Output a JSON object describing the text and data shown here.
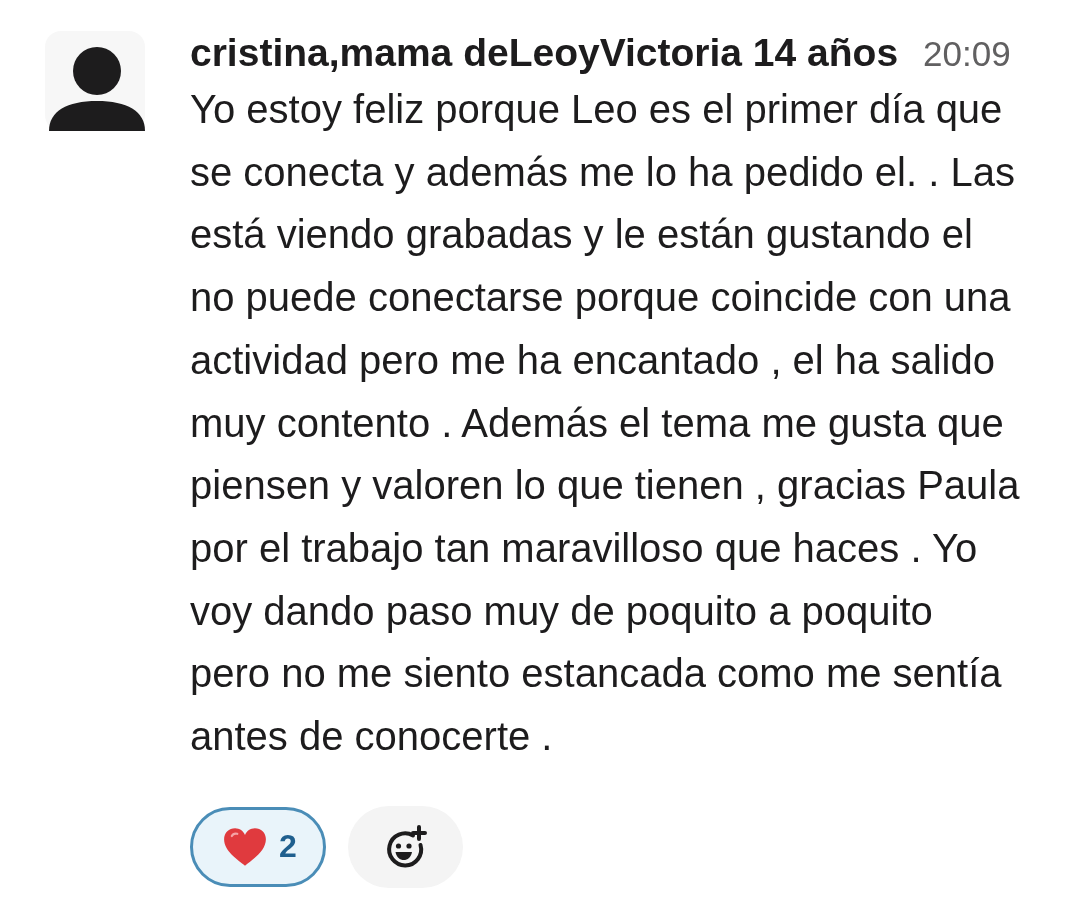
{
  "message": {
    "sender": "cristina,mama deLeoyVictoria 14 años",
    "time": "20:09",
    "text": "Yo estoy feliz porque Leo es el primer día que se conecta y además me lo ha pedido el. . Las está viendo grabadas y le están gustando el no puede conectarse porque coincide con una actividad pero me ha encantado , el ha salido muy contento . Además el tema me gusta que piensen y valoren lo que tienen , gracias Paula por el trabajo tan maravilloso que haces . Yo voy dando paso muy de poquito a poquito pero no me siento estancada como me sentía antes de conocerte .",
    "reactions": [
      {
        "count": "2",
        "selected": true
      }
    ]
  }
}
